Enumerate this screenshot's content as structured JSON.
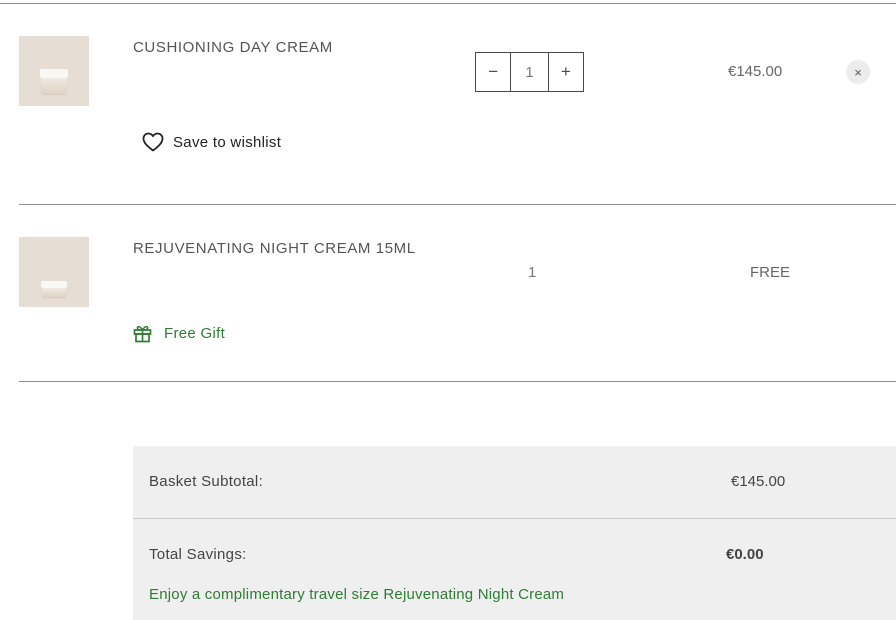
{
  "basket": {
    "items": [
      {
        "name": "CUSHIONING DAY CREAM",
        "quantity": "1",
        "price": "€145.00",
        "decrease_symbol": "−",
        "increase_symbol": "+",
        "remove_symbol": "×",
        "action_label": "Save to wishlist",
        "action_icon": "heart-icon"
      },
      {
        "name": "REJUVENATING NIGHT CREAM 15ML",
        "quantity": "1",
        "price": "FREE",
        "tag_label": "Free Gift",
        "tag_icon": "gift-icon"
      }
    ]
  },
  "summary": {
    "subtotal_label": "Basket Subtotal:",
    "subtotal_value": "€145.00",
    "savings_label": "Total Savings:",
    "savings_value": "€0.00",
    "promo_message": "Enjoy a complimentary travel size Rejuvenating Night Cream"
  },
  "colors": {
    "promo_green": "#2e7d32",
    "thumb_bg": "#e6ddd4",
    "summary_bg": "#efefef"
  }
}
